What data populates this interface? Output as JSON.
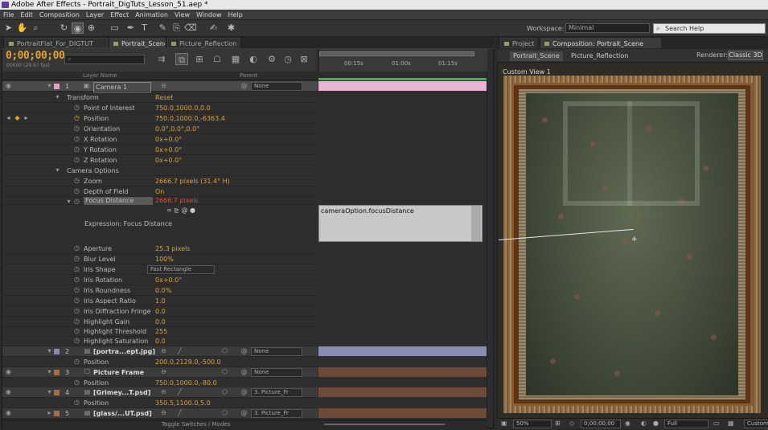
{
  "window": {
    "title": "Adobe After Effects - Portrait_DigTuts_Lesson_51.aep *"
  },
  "menu": [
    "File",
    "Edit",
    "Composition",
    "Layer",
    "Effect",
    "Animation",
    "View",
    "Window",
    "Help"
  ],
  "toolbar": {
    "workspace_label": "Workspace:",
    "workspace_value": "Minimal",
    "search_placeholder": "Search Help"
  },
  "left_tabs": [
    "PortraitFlat_For_DIGTUT",
    "Portrait_Scene",
    "Picture_Reflection"
  ],
  "timeline": {
    "timecode": "0;00;00;00",
    "frames": "00000 (29.97 fps)",
    "search_placeholder": "",
    "ruler_labels": [
      "00:15s",
      "01:00s",
      "01:15s"
    ],
    "col_layer_name": "Layer Name",
    "col_parent": "Parent",
    "expression_text": "cameraOption.focusDistance",
    "expression_label": "Expression: Focus Distance",
    "toggle_label": "Toggle Switches / Modes"
  },
  "rows": [
    {
      "num": "1",
      "name": "Camera 1",
      "type": "layer",
      "parent": "None"
    },
    {
      "name": "Transform",
      "value": "Reset",
      "type": "group"
    },
    {
      "name": "Point of Interest",
      "value": "750.0,1000.0,0.0",
      "type": "prop"
    },
    {
      "name": "Position",
      "value": "750.0,1000.0,-6363.4",
      "type": "prop"
    },
    {
      "name": "Orientation",
      "value": "0.0°,0.0°,0.0°",
      "type": "prop"
    },
    {
      "name": "X Rotation",
      "value": "0x+0.0°",
      "type": "prop"
    },
    {
      "name": "Y Rotation",
      "value": "0x+0.0°",
      "type": "prop"
    },
    {
      "name": "Z Rotation",
      "value": "0x+0.0°",
      "type": "prop"
    },
    {
      "name": "Camera Options",
      "value": "",
      "type": "group"
    },
    {
      "name": "Zoom",
      "value": "2666.7 pixels (31.4° H)",
      "type": "prop"
    },
    {
      "name": "Depth of Field",
      "value": "On",
      "type": "prop"
    },
    {
      "name": "Focus Distance",
      "value": "2666.7 pixels",
      "type": "prop"
    },
    {
      "name": "Aperture",
      "value": "25.3 pixels",
      "type": "prop"
    },
    {
      "name": "Blur Level",
      "value": "100%",
      "type": "prop"
    },
    {
      "name": "Iris Shape",
      "value": "Fast Rectangle",
      "type": "prop"
    },
    {
      "name": "Iris Rotation",
      "value": "0x+0.0°",
      "type": "prop"
    },
    {
      "name": "Iris Roundness",
      "value": "0.0%",
      "type": "prop"
    },
    {
      "name": "Iris Aspect Ratio",
      "value": "1.0",
      "type": "prop"
    },
    {
      "name": "Iris Diffraction Fringe",
      "value": "0.0",
      "type": "prop"
    },
    {
      "name": "Highlight Gain",
      "value": "0.0",
      "type": "prop"
    },
    {
      "name": "Highlight Threshold",
      "value": "255",
      "type": "prop"
    },
    {
      "name": "Highlight Saturation",
      "value": "0.0",
      "type": "prop"
    },
    {
      "num": "2",
      "name": "[portra...ept.jpg]",
      "type": "layer",
      "parent": "None"
    },
    {
      "name": "Position",
      "value": "200.0,2129.0,-500.0",
      "type": "prop"
    },
    {
      "num": "3",
      "name": "Picture Frame",
      "type": "layer",
      "parent": "None"
    },
    {
      "name": "Position",
      "value": "750.0,1000.0,-80.0",
      "type": "prop"
    },
    {
      "num": "4",
      "name": "[Grimey...T.psd]",
      "type": "layer",
      "parent": "3. Picture_Fr"
    },
    {
      "name": "Position",
      "value": "350.5,1100.0,5.0",
      "type": "prop"
    },
    {
      "num": "5",
      "name": "[glass/...UT.psd]",
      "type": "layer",
      "parent": "3. Picture_Fr"
    }
  ],
  "right": {
    "tabs": [
      "Project",
      "Composition: Portrait_Scene"
    ],
    "crumbs": [
      "Portrait_Scene",
      "Picture_Reflection"
    ],
    "renderer_label": "Renderer:",
    "renderer_value": "Classic 3D",
    "view_label": "Custom View 1",
    "bottom": {
      "zoom": "50%",
      "time": "0;00;00;00",
      "quality": "Full",
      "view": "Custom"
    }
  },
  "colors": {
    "accent": "#e6a21f",
    "value": "#d8a23a",
    "green": "#3db24b"
  }
}
